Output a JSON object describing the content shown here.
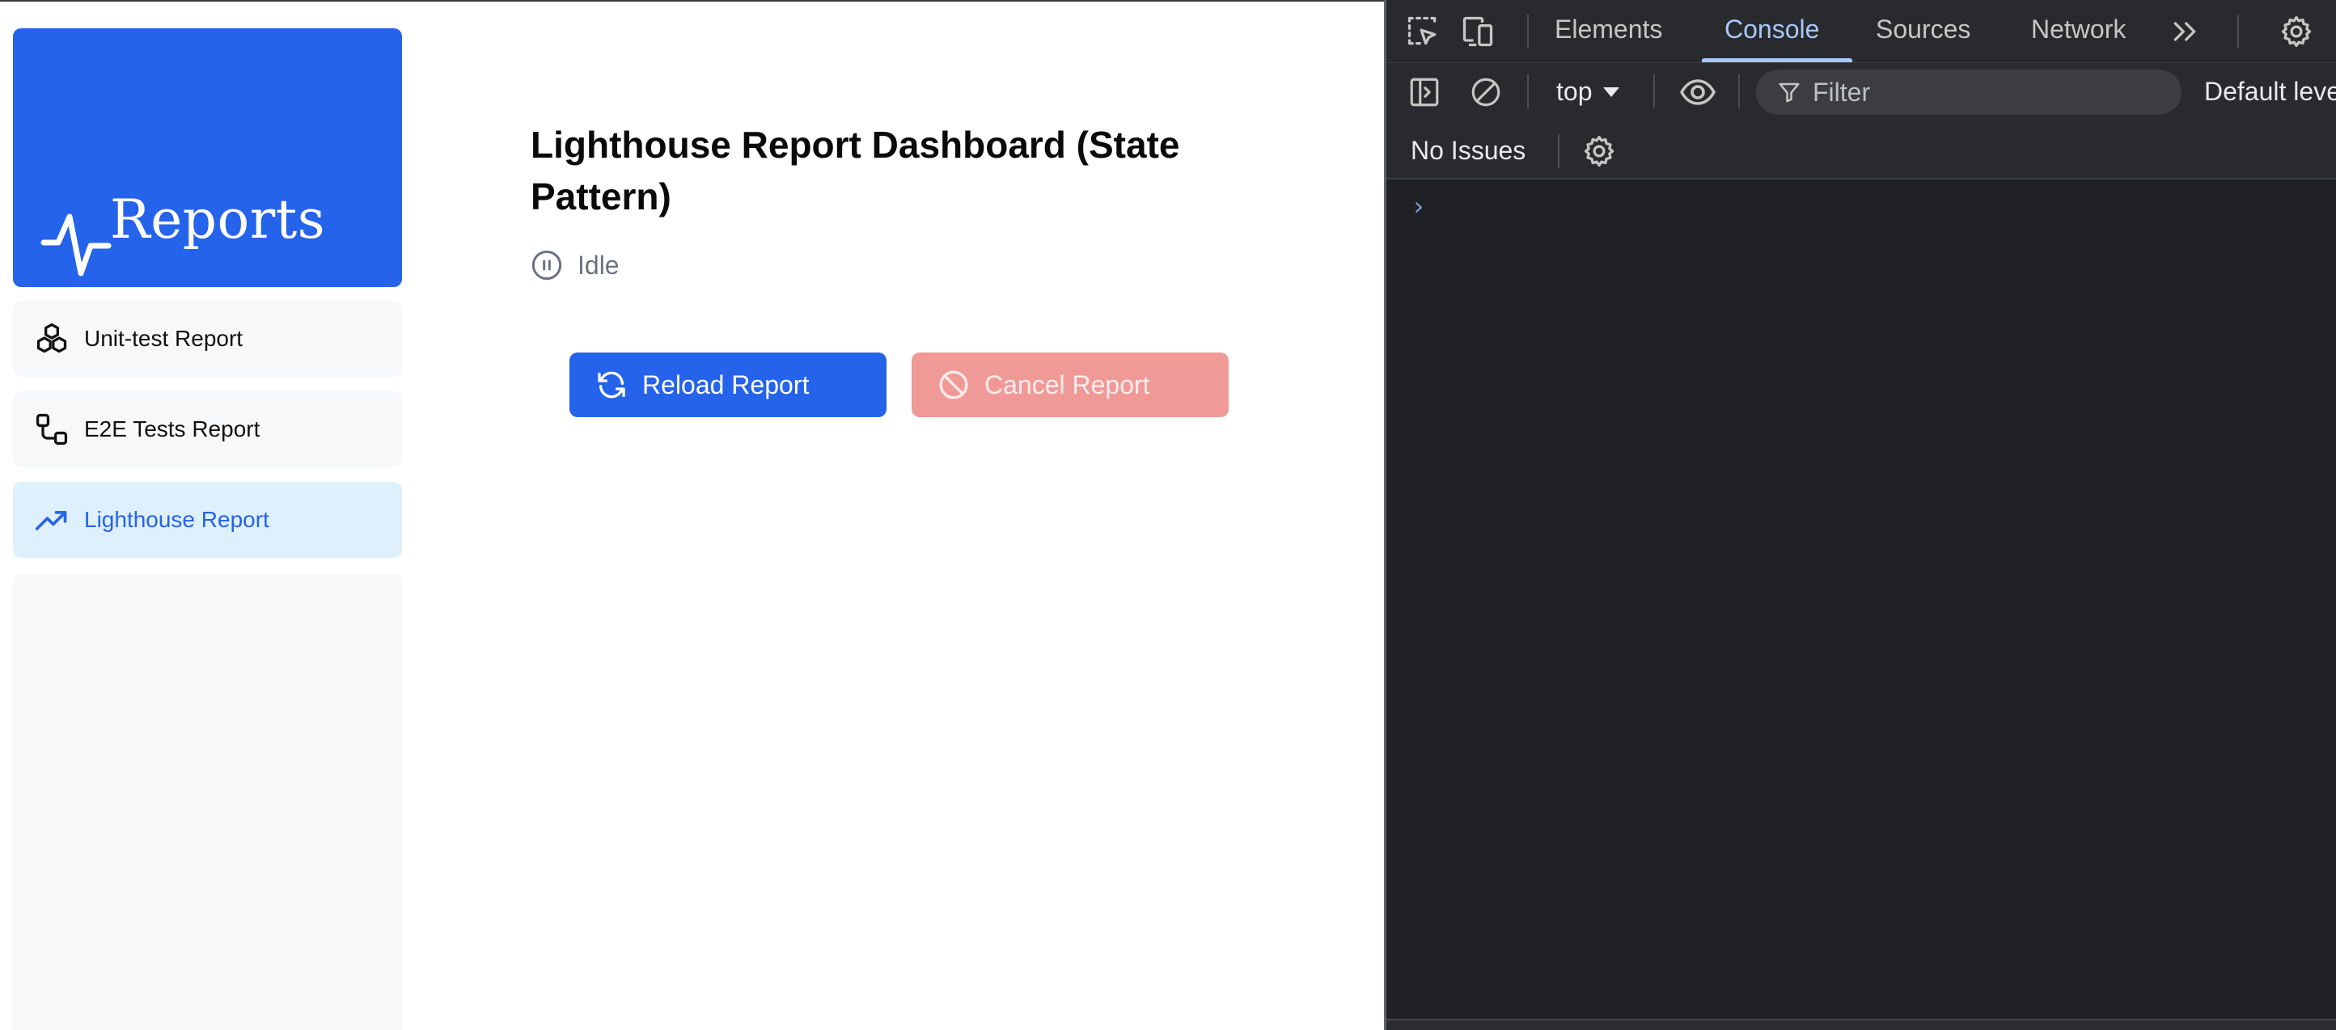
{
  "app": {
    "brand": {
      "text": "Reports",
      "color": "#2563eb"
    },
    "nav": [
      {
        "label": "Unit-test Report",
        "icon": "boxes-icon"
      },
      {
        "label": "E2E Tests Report",
        "icon": "workflow-icon"
      },
      {
        "label": "Lighthouse Report",
        "icon": "trending-up-icon",
        "active": true
      }
    ],
    "main": {
      "title": "Lighthouse Report Dashboard (State Pattern)",
      "status": {
        "text": "Idle",
        "icon": "pause-circle-icon"
      },
      "buttons": {
        "reload": {
          "label": "Reload Report",
          "icon": "refresh-icon",
          "color": "#2563eb"
        },
        "cancel": {
          "label": "Cancel Report",
          "icon": "ban-icon",
          "color": "#f09a98",
          "disabled": true
        }
      }
    }
  },
  "devtools": {
    "tabs": [
      "Elements",
      "Console",
      "Sources",
      "Network"
    ],
    "active_tab": "Console",
    "toolbar": {
      "context": "top",
      "filter_placeholder": "Filter",
      "levels": "Default levels"
    },
    "issues_text": "No Issues",
    "prompt": "›"
  }
}
